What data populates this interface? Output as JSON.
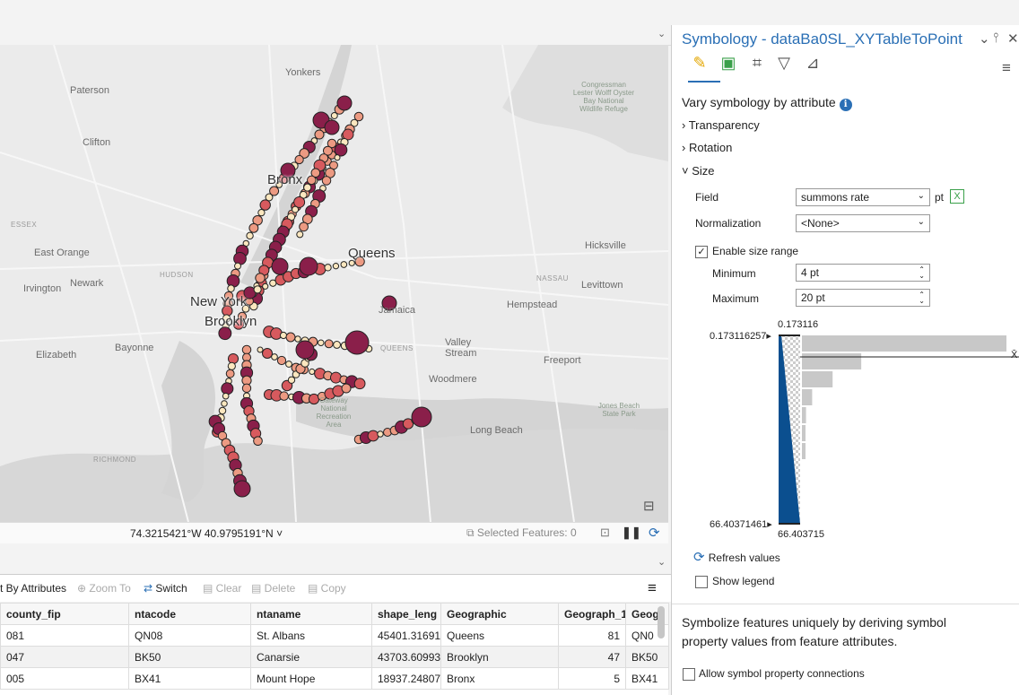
{
  "colors": {
    "accent": "#2a6fb5",
    "ramp_light": "#fde9c0",
    "ramp_mid": "#d9655c",
    "ramp_dark": "#8a1f4a",
    "histo_fill": "#0b4f8f"
  },
  "map": {
    "places": [
      {
        "name": "Yonkers",
        "kind": "normal"
      },
      {
        "name": "Paterson",
        "kind": "normal"
      },
      {
        "name": "Clifton",
        "kind": "normal"
      },
      {
        "name": "ESSEX",
        "kind": "tiny"
      },
      {
        "name": "East Orange",
        "kind": "normal"
      },
      {
        "name": "HUDSON",
        "kind": "tiny"
      },
      {
        "name": "Irvington",
        "kind": "normal"
      },
      {
        "name": "Newark",
        "kind": "normal"
      },
      {
        "name": "Bronx",
        "kind": "big"
      },
      {
        "name": "Queens",
        "kind": "big"
      },
      {
        "name": "New York",
        "kind": "big"
      },
      {
        "name": "Brooklyn",
        "kind": "big"
      },
      {
        "name": "Bayonne",
        "kind": "normal"
      },
      {
        "name": "Elizabeth",
        "kind": "normal"
      },
      {
        "name": "QUEENS",
        "kind": "tiny"
      },
      {
        "name": "Valley Stream",
        "kind": "normal"
      },
      {
        "name": "Hempstead",
        "kind": "normal"
      },
      {
        "name": "Hicksville",
        "kind": "normal"
      },
      {
        "name": "NASSAU",
        "kind": "tiny"
      },
      {
        "name": "Levittown",
        "kind": "normal"
      },
      {
        "name": "Freeport",
        "kind": "normal"
      },
      {
        "name": "Woodmere",
        "kind": "normal"
      },
      {
        "name": "Long Beach",
        "kind": "normal"
      },
      {
        "name": "RICHMOND",
        "kind": "tiny"
      },
      {
        "name": "Jamaica",
        "kind": "normal"
      }
    ],
    "parks": [
      {
        "name": "Congressman Lester Wolff Oyster Bay National Wildlife Refuge"
      },
      {
        "name": "Gateway National Recreation Area"
      },
      {
        "name": "Jones Beach State Park"
      }
    ]
  },
  "statusbar": {
    "coords": "74.3215421°W 40.9795191°N",
    "coords_chev": "˅",
    "selected": "Selected Features: 0"
  },
  "table_toolbar": {
    "select_by": "t By Attributes",
    "zoom_to": "Zoom To",
    "switch": "Switch",
    "clear": "Clear",
    "delete": "Delete",
    "copy": "Copy",
    "menu": "≡"
  },
  "table": {
    "columns": [
      "county_fip",
      "ntacode",
      "ntaname",
      "shape_leng",
      "Geographic",
      "Geograph_1",
      "Geog"
    ],
    "rows": [
      [
        "081",
        "QN08",
        "St. Albans",
        "45401.316915",
        "Queens",
        "81",
        "QN0"
      ],
      [
        "047",
        "BK50",
        "Canarsie",
        "43703.609937",
        "Brooklyn",
        "47",
        "BK50"
      ],
      [
        "005",
        "BX41",
        "Mount Hope",
        "18937.248075",
        "Bronx",
        "5",
        "BX41"
      ]
    ]
  },
  "pane": {
    "title": "Symbology - dataBa0SL_XYTableToPoint",
    "ctl_chev": "⌄",
    "ctl_pin": "⫯",
    "ctl_close": "✕",
    "menu": "≡",
    "heading": "Vary symbology by attribute",
    "info_icon": "i",
    "transparency": "Transparency",
    "rotation": "Rotation",
    "size": "Size",
    "field_label": "Field",
    "field_value": "summons rate",
    "unit": "pt",
    "normalization_label": "Normalization",
    "normalization_value": "<None>",
    "enable_size_range": "Enable size range",
    "minimum_label": "Minimum",
    "minimum_value": "4 pt",
    "maximum_label": "Maximum",
    "maximum_value": "20 pt",
    "histo_top_label": "0.173116",
    "histo_top_value": "0.173116257",
    "histo_bottom_label": "66.403715",
    "histo_bottom_value": "66.40371461",
    "histo_x": "X̄",
    "refresh": "Refresh values",
    "show_legend": "Show legend",
    "footer": "Symbolize features uniquely by deriving symbol property values from feature attributes.",
    "allow_connections": "Allow symbol property connections"
  },
  "histogram": {
    "bars": [
      1.0,
      0.29,
      0.15,
      0.05,
      0.02,
      0.01,
      0.01
    ]
  }
}
